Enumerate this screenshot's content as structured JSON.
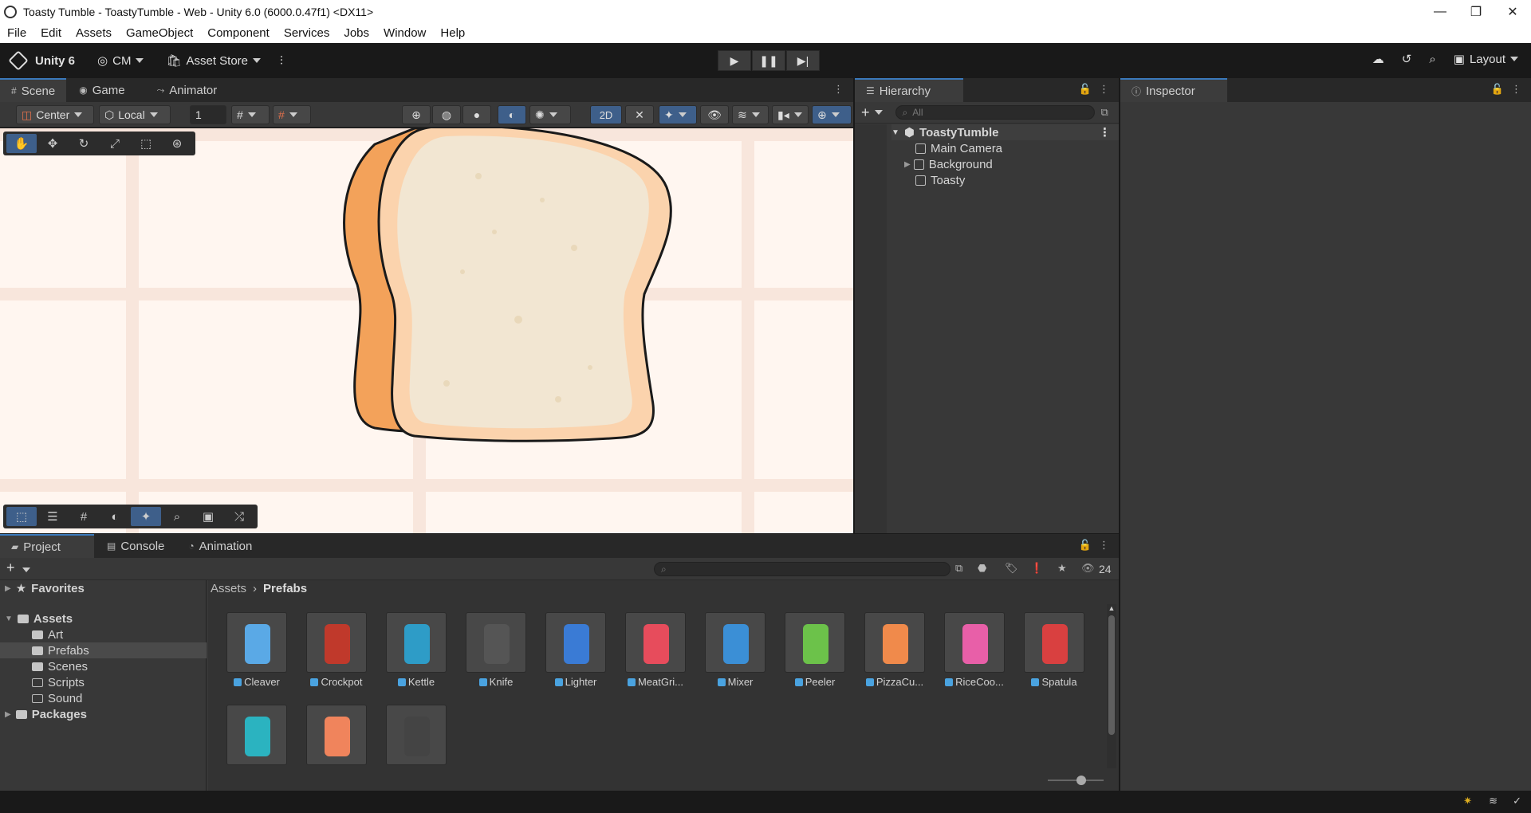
{
  "window": {
    "title": "Toasty Tumble - ToastyTumble - Web - Unity 6.0 (6000.0.47f1) <DX11>",
    "minimize": "—",
    "restore": "❐",
    "close": "✕"
  },
  "menu": [
    "File",
    "Edit",
    "Assets",
    "GameObject",
    "Component",
    "Services",
    "Jobs",
    "Window",
    "Help"
  ],
  "toolbar": {
    "product": "Unity 6",
    "account": "CM",
    "asset_store": "Asset Store",
    "layout": "Layout"
  },
  "scene_tabs": [
    {
      "label": "Scene",
      "icon": "#"
    },
    {
      "label": "Game",
      "icon": "◉"
    },
    {
      "label": "Animator",
      "icon": "⤳"
    }
  ],
  "scene_toolbar": {
    "pivot": "Center",
    "space": "Local",
    "grid_snap": "1",
    "mode_2d": "2D"
  },
  "hierarchy": {
    "tab": "Hierarchy",
    "search_placeholder": "All",
    "scene": "ToastyTumble",
    "items": [
      "Main Camera",
      "Background",
      "Toasty"
    ]
  },
  "inspector": {
    "tab": "Inspector"
  },
  "bottom_tabs": [
    {
      "label": "Project"
    },
    {
      "label": "Console"
    },
    {
      "label": "Animation"
    }
  ],
  "project": {
    "visible_count": "24",
    "favorites": "Favorites",
    "assets_root": "Assets",
    "folders": [
      "Art",
      "Prefabs",
      "Scenes",
      "Scripts",
      "Sound"
    ],
    "packages": "Packages",
    "breadcrumb": [
      "Assets",
      "Prefabs"
    ],
    "assets": [
      {
        "label": "Cleaver",
        "color": "#5aa9e6"
      },
      {
        "label": "Crockpot",
        "color": "#c0392b"
      },
      {
        "label": "Kettle",
        "color": "#2e9cc7"
      },
      {
        "label": "Knife",
        "color": "#555555"
      },
      {
        "label": "Lighter",
        "color": "#3a7bd5"
      },
      {
        "label": "MeatGri...",
        "color": "#e74c5c"
      },
      {
        "label": "Mixer",
        "color": "#3b8fd6"
      },
      {
        "label": "Peeler",
        "color": "#6cc24a"
      },
      {
        "label": "PizzaCu...",
        "color": "#f08a4b"
      },
      {
        "label": "RiceCoo...",
        "color": "#e85fa8"
      },
      {
        "label": "Spatula",
        "color": "#d94040"
      },
      {
        "label": "",
        "color": "#2bb3c0"
      },
      {
        "label": "",
        "color": "#f0845c"
      },
      {
        "label": "",
        "color": "#444444"
      }
    ]
  },
  "colors": {
    "accent": "#3a79bb",
    "bread_crust": "#f3a25a",
    "bread_inside": "#f2e6d2",
    "scene_bg": "#fff6f0"
  }
}
